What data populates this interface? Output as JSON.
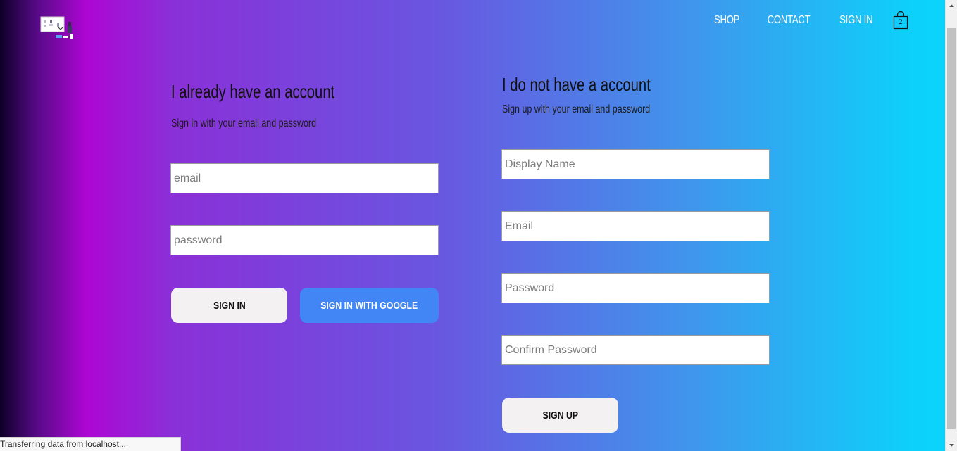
{
  "nav": {
    "shop": "SHOP",
    "contact": "CONTACT",
    "sign_in": "SIGN IN",
    "cart_count": "2"
  },
  "sign_in": {
    "title": "I already have an account",
    "subtitle": "Sign in with your email and password",
    "email_placeholder": "email",
    "password_placeholder": "password",
    "submit_label": "SIGN IN",
    "google_label": "SIGN IN WITH GOOGLE"
  },
  "sign_up": {
    "title": "I do not have a account",
    "subtitle": "Sign up with your email and password",
    "display_name_placeholder": "Display Name",
    "email_placeholder": "Email",
    "password_placeholder": "Password",
    "confirm_password_placeholder": "Confirm Password",
    "submit_label": "SIGN UP"
  },
  "status_bar": {
    "text": "Transferring data from localhost..."
  },
  "colors": {
    "google_blue": "#4285f4",
    "button_light": "#f3f1f1"
  }
}
